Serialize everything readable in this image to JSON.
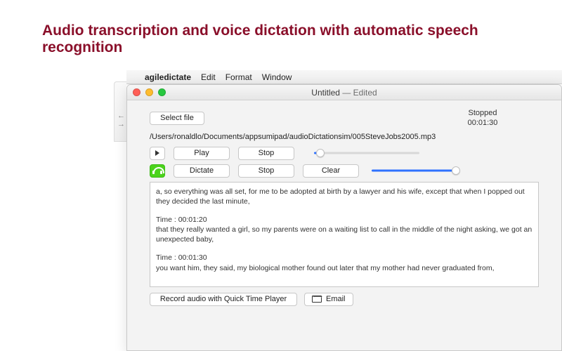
{
  "headline": "Audio transcription and voice dictation with automatic speech recognition",
  "menubar": {
    "apple_symbol": "",
    "app_name": "agiledictate",
    "items": [
      "Edit",
      "Format",
      "Window"
    ]
  },
  "ghost_nav": "← →",
  "window": {
    "title_primary": "Untitled",
    "title_secondary": " — Edited"
  },
  "controls": {
    "select_file": "Select file",
    "play": "Play",
    "stop": "Stop",
    "dictate": "Dictate",
    "clear": "Clear",
    "record_qtp": "Record audio with Quick Time Player",
    "email": "Email"
  },
  "status": {
    "state": "Stopped",
    "time": "00:01:30"
  },
  "file_path": "/Users/ronaldlo/Documents/appsumipad/audioDictationsim/005SteveJobs2005.mp3",
  "sliders": {
    "position_pct": 6,
    "volume_pct": 100
  },
  "transcript": {
    "top_fragment": "a, so everything was all set, for me to be adopted at birth by a lawyer and his wife, except that when I popped out they decided the last minute,",
    "blocks": [
      {
        "time_label": "Time : 00:01:20",
        "text": "that they really wanted a girl, so my parents were on a waiting list to call in the middle of the night asking, we got an unexpected baby,"
      },
      {
        "time_label": "Time : 00:01:30",
        "text": "you want him, they said, my biological mother found out later that my mother had never graduated from,"
      }
    ]
  }
}
